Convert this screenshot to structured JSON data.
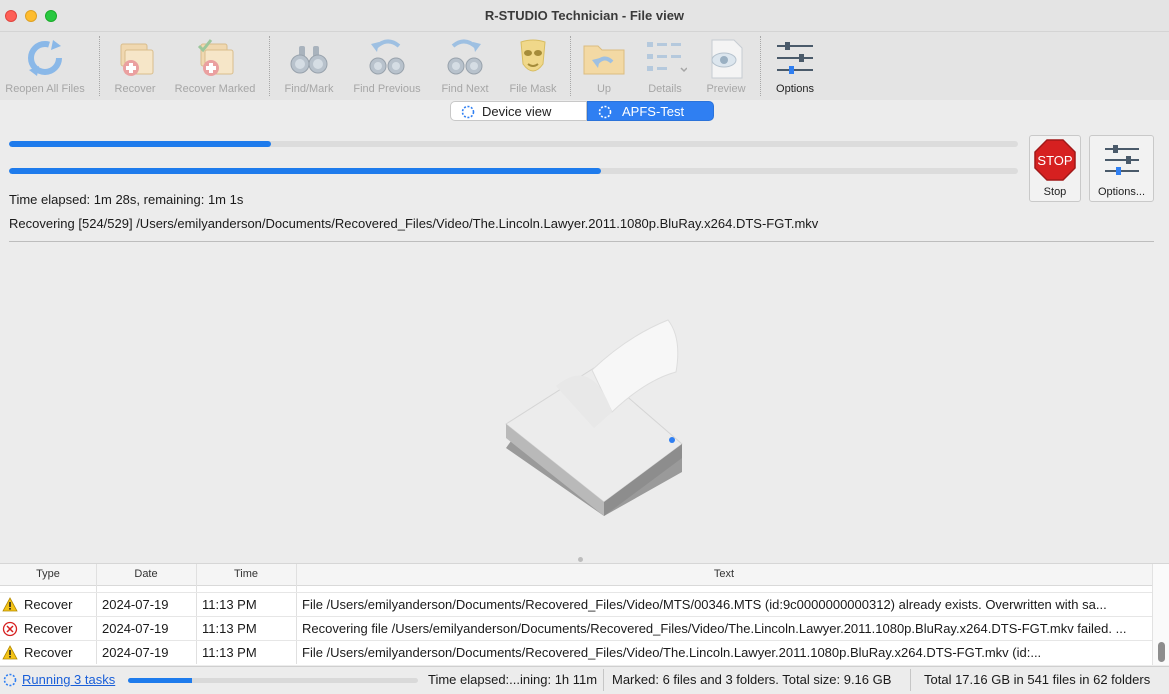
{
  "window": {
    "title": "R-STUDIO Technician - File view"
  },
  "toolbar": {
    "items": [
      {
        "label": "Reopen All Files",
        "icon": "reopen-icon"
      },
      {
        "label": "Recover",
        "icon": "recover-icon"
      },
      {
        "label": "Recover Marked",
        "icon": "recover-marked-icon"
      },
      {
        "label": "Find/Mark",
        "icon": "binoculars-icon"
      },
      {
        "label": "Find Previous",
        "icon": "find-previous-icon"
      },
      {
        "label": "Find Next",
        "icon": "find-next-icon"
      },
      {
        "label": "File Mask",
        "icon": "mask-icon"
      },
      {
        "label": "Up",
        "icon": "folder-up-icon"
      },
      {
        "label": "Details",
        "icon": "details-icon"
      },
      {
        "label": "Preview",
        "icon": "preview-icon"
      },
      {
        "label": "Options",
        "icon": "sliders-icon"
      }
    ]
  },
  "tabs": [
    {
      "label": "Device view",
      "active": false
    },
    {
      "label": "APFS-Test",
      "active": true
    }
  ],
  "progress": {
    "bar1": 0.26,
    "bar2": 0.587,
    "elapsed": "Time elapsed: 1m 28s, remaining: 1m 1s",
    "recovering": "Recovering [524/529] /Users/emilyanderson/Documents/Recovered_Files/Video/The.Lincoln.Lawyer.2011.1080p.BluRay.x264.DTS-FGT.mkv"
  },
  "actions": {
    "stop": {
      "label": "Stop",
      "sign": "STOP"
    },
    "options": {
      "label": "Options..."
    }
  },
  "log": {
    "columns": [
      "Type",
      "Date",
      "Time",
      "Text"
    ],
    "rows": [
      {
        "icon": "warning-icon",
        "type": "Recover",
        "date": "2024-07-19",
        "time": "11:13 PM",
        "text": "File /Users/emilyanderson/Documents/Recovered_Files/Video/MTS/00346.MTS (id:9c0000000000312) already exists. Overwritten with sa..."
      },
      {
        "icon": "error-icon",
        "type": "Recover",
        "date": "2024-07-19",
        "time": "11:13 PM",
        "text": "Recovering file /Users/emilyanderson/Documents/Recovered_Files/Video/The.Lincoln.Lawyer.2011.1080p.BluRay.x264.DTS-FGT.mkv failed. ..."
      },
      {
        "icon": "warning-icon",
        "type": "Recover",
        "date": "2024-07-19",
        "time": "11:13 PM",
        "text": "File /Users/emilyanderson/Documents/Recovered_Files/Video/The.Lincoln.Lawyer.2011.1080p.BluRay.x264.DTS-FGT.mkv (id:..."
      }
    ]
  },
  "status": {
    "running": "Running 3 tasks",
    "mini_progress": 0.22,
    "elapsed": "Time elapsed:...ining: 1h 11m",
    "marked": "Marked: 6 files and 3 folders. Total size: 9.16 GB",
    "total": "Total 17.16 GB in 541 files in 62 folders"
  },
  "colors": {
    "accent": "#1e7bec",
    "tab_active": "#2f7ff2",
    "stop": "#d62020",
    "link": "#1a5fd8"
  }
}
